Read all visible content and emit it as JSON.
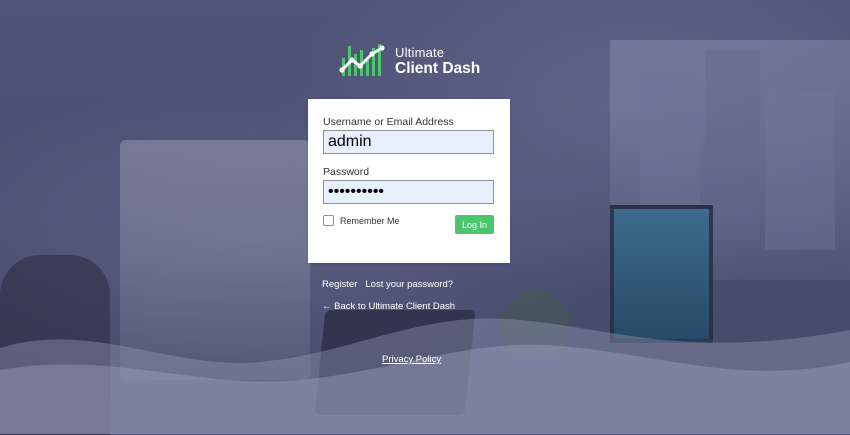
{
  "brand": {
    "line1": "Ultimate",
    "line2": "Client Dash",
    "accent": "#4cc56e",
    "logo_icon": "chart-line-icon"
  },
  "form": {
    "username_label": "Username or Email Address",
    "username_value": "admin",
    "password_label": "Password",
    "password_value": "••••••••••",
    "remember_label": "Remember Me",
    "remember_checked": false,
    "login_label": "Log In"
  },
  "links": {
    "register": "Register",
    "lost_password": "Lost your password?",
    "back": "← Back to Ultimate Client Dash",
    "privacy": "Privacy Policy"
  },
  "colors": {
    "background": "#4a4f72",
    "card": "#ffffff",
    "input_fill": "#e8f0fe",
    "button": "#4cc56e"
  }
}
